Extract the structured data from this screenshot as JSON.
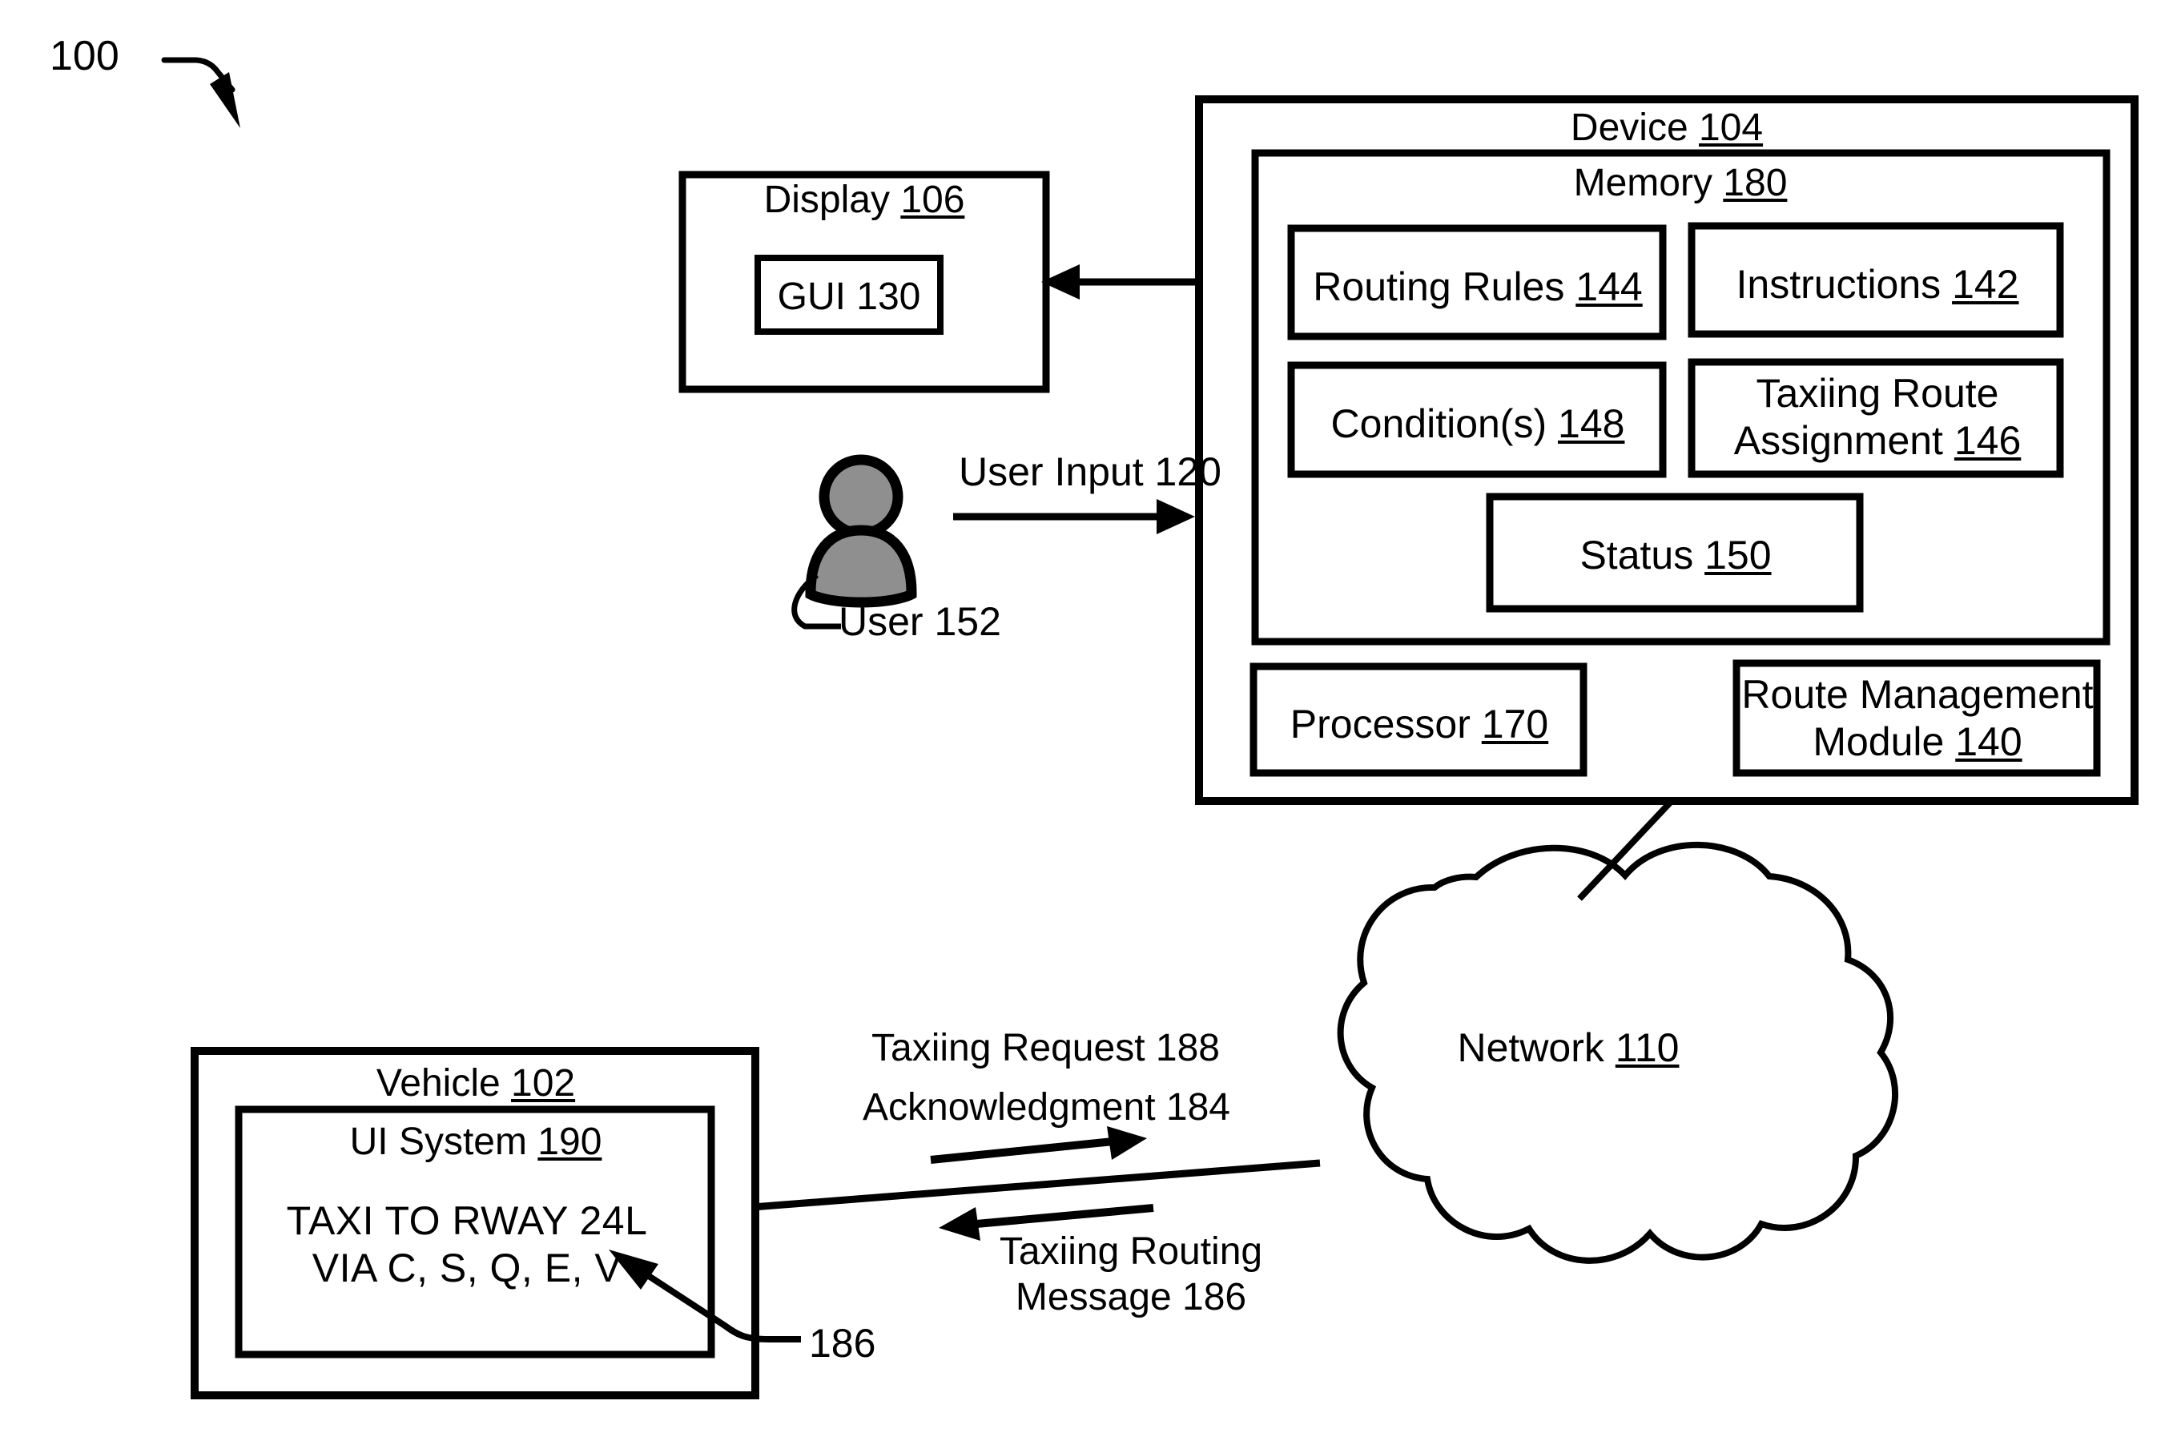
{
  "figure": {
    "figure_number": "100",
    "background_color": "#ffffff",
    "line_color": "#000000"
  },
  "display_panel": {
    "title": "Display",
    "title_ref": "106",
    "gui": {
      "label": "GUI 130"
    }
  },
  "device_panel": {
    "title": "Device",
    "title_ref": "104",
    "memory": {
      "title": "Memory",
      "title_ref": "180",
      "blocks": [
        {
          "label": "Routing Rules",
          "ref": "144",
          "name": "routing-rules-block"
        },
        {
          "label": "Instructions",
          "ref": "142",
          "name": "instructions-block"
        },
        {
          "label": "Condition(s)",
          "ref": "148",
          "name": "conditions-block"
        },
        {
          "label_line1": "Taxiing Route",
          "label_line2": "Assignment",
          "ref": "146",
          "name": "taxiing-route-assignment-block"
        },
        {
          "label": "Status",
          "ref": "150",
          "name": "status-block"
        }
      ]
    },
    "processor": {
      "label": "Processor",
      "ref": "170"
    },
    "route_management_module": {
      "label_line1": "Route Management",
      "label_line2": "Module",
      "ref": "140"
    }
  },
  "user": {
    "label": "User 152",
    "input_label": "User Input 120"
  },
  "network": {
    "label": "Network",
    "ref": "110"
  },
  "vehicle_panel": {
    "title": "Vehicle",
    "title_ref": "102",
    "ui_system": {
      "title": "UI System",
      "title_ref": "190",
      "message_line1": "TAXI TO RWAY 24L",
      "message_line2": "VIA C, S, Q, E, V"
    },
    "callout_ref": "186"
  },
  "messages": {
    "taxiing_request": "Taxiing Request 188",
    "acknowledgment": "Acknowledgment 184",
    "taxiing_routing_line1": "Taxiing Routing",
    "taxiing_routing_line2": "Message 186"
  }
}
